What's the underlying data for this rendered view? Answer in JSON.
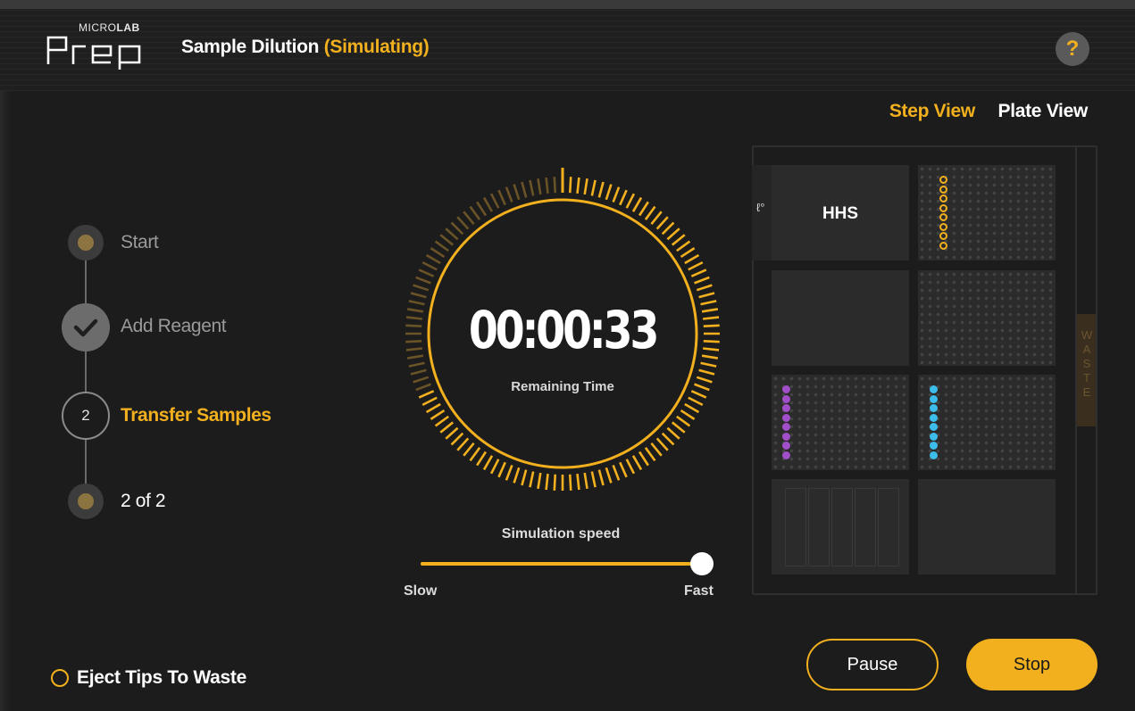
{
  "app": {
    "logo_top_thin": "MICRO",
    "logo_top_bold": "LAB",
    "logo_main": "Prep",
    "title": "Sample Dilution",
    "title_status": "(Simulating)",
    "help_label": "?"
  },
  "view_tabs": [
    {
      "label": "Step View",
      "active": true
    },
    {
      "label": "Plate View",
      "active": false
    }
  ],
  "steps": [
    {
      "label": "Start",
      "state": "done-dot"
    },
    {
      "label": "Add Reagent",
      "state": "completed"
    },
    {
      "label": "Transfer Samples",
      "state": "active",
      "number": "2"
    },
    {
      "label": "2 of 2",
      "state": "pending"
    }
  ],
  "timer": {
    "time": "00:00:33",
    "label": "Remaining Time",
    "progress_fraction": 0.68
  },
  "simulation": {
    "label": "Simulation speed",
    "slow_label": "Slow",
    "fast_label": "Fast",
    "value_fraction": 1.0
  },
  "deck": {
    "hhs_label": "HHS",
    "thermometer_icon": "thermometer-icon",
    "waste_label": "WASTE",
    "colors": {
      "accent": "#f2b01e",
      "purple": "#a04fc8",
      "blue": "#3dbde9"
    }
  },
  "footer": {
    "eject_label": "Eject Tips To Waste",
    "pause_label": "Pause",
    "stop_label": "Stop"
  }
}
